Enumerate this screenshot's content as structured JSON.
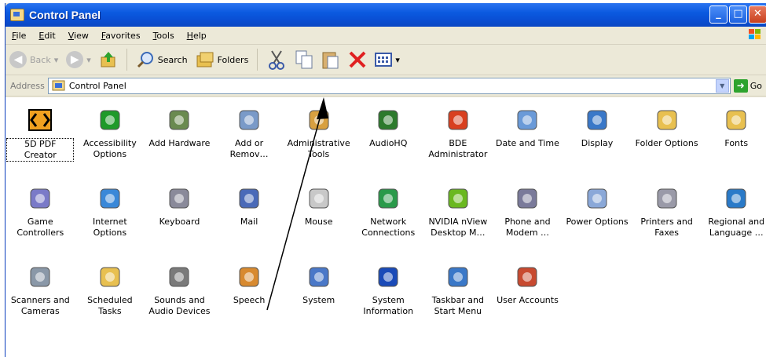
{
  "window": {
    "title": "Control Panel"
  },
  "menu": [
    "File",
    "Edit",
    "View",
    "Favorites",
    "Tools",
    "Help"
  ],
  "toolbar": {
    "back": "Back",
    "search": "Search",
    "folders": "Folders"
  },
  "address": {
    "label": "Address",
    "value": "Control Panel",
    "go": "Go"
  },
  "items": [
    {
      "label": "5D PDF Creator",
      "icon": "pdf-creator-icon",
      "color": "#f0a020"
    },
    {
      "label": "Accessibility Options",
      "icon": "accessibility-icon",
      "color": "#1f9a2a"
    },
    {
      "label": "Add Hardware",
      "icon": "add-hardware-icon",
      "color": "#6a8a50"
    },
    {
      "label": "Add or Remov…",
      "icon": "add-remove-programs-icon",
      "color": "#7a9ac8"
    },
    {
      "label": "Administrative Tools",
      "icon": "admin-tools-icon",
      "color": "#d8a040"
    },
    {
      "label": "AudioHQ",
      "icon": "audiohq-icon",
      "color": "#2c7a2c"
    },
    {
      "label": "BDE Administrator",
      "icon": "bde-admin-icon",
      "color": "#d84020"
    },
    {
      "label": "Date and Time",
      "icon": "date-time-icon",
      "color": "#6a9ad8"
    },
    {
      "label": "Display",
      "icon": "display-icon",
      "color": "#3a78c8"
    },
    {
      "label": "Folder Options",
      "icon": "folder-options-icon",
      "color": "#e8c050"
    },
    {
      "label": "Fonts",
      "icon": "fonts-icon",
      "color": "#e8c050"
    },
    {
      "label": "Game Controllers",
      "icon": "game-controllers-icon",
      "color": "#7a7ac8"
    },
    {
      "label": "Internet Options",
      "icon": "internet-options-icon",
      "color": "#3a88d8"
    },
    {
      "label": "Keyboard",
      "icon": "keyboard-icon",
      "color": "#8a8a9a"
    },
    {
      "label": "Mail",
      "icon": "mail-icon",
      "color": "#4a6ab8"
    },
    {
      "label": "Mouse",
      "icon": "mouse-icon",
      "color": "#c8c8c8"
    },
    {
      "label": "Network Connections",
      "icon": "network-connections-icon",
      "color": "#2a9a4a"
    },
    {
      "label": "NVIDIA nView Desktop M…",
      "icon": "nvidia-icon",
      "color": "#6ab820"
    },
    {
      "label": "Phone and Modem …",
      "icon": "phone-modem-icon",
      "color": "#7a7a9a"
    },
    {
      "label": "Power Options",
      "icon": "power-options-icon",
      "color": "#8aa8d8"
    },
    {
      "label": "Printers and Faxes",
      "icon": "printers-icon",
      "color": "#9a9aa8"
    },
    {
      "label": "Regional and Language …",
      "icon": "regional-language-icon",
      "color": "#2a7ac8"
    },
    {
      "label": "Scanners and Cameras",
      "icon": "scanners-cameras-icon",
      "color": "#8a98a8"
    },
    {
      "label": "Scheduled Tasks",
      "icon": "scheduled-tasks-icon",
      "color": "#e8c050"
    },
    {
      "label": "Sounds and Audio Devices",
      "icon": "sounds-icon",
      "color": "#7a7a7a"
    },
    {
      "label": "Speech",
      "icon": "speech-icon",
      "color": "#d88a30"
    },
    {
      "label": "System",
      "icon": "system-icon",
      "color": "#4a78c8"
    },
    {
      "label": "System Information",
      "icon": "system-information-icon",
      "color": "#1a4ab8"
    },
    {
      "label": "Taskbar and Start Menu",
      "icon": "taskbar-icon",
      "color": "#3a78c8"
    },
    {
      "label": "User Accounts",
      "icon": "user-accounts-icon",
      "color": "#c84a30"
    }
  ]
}
